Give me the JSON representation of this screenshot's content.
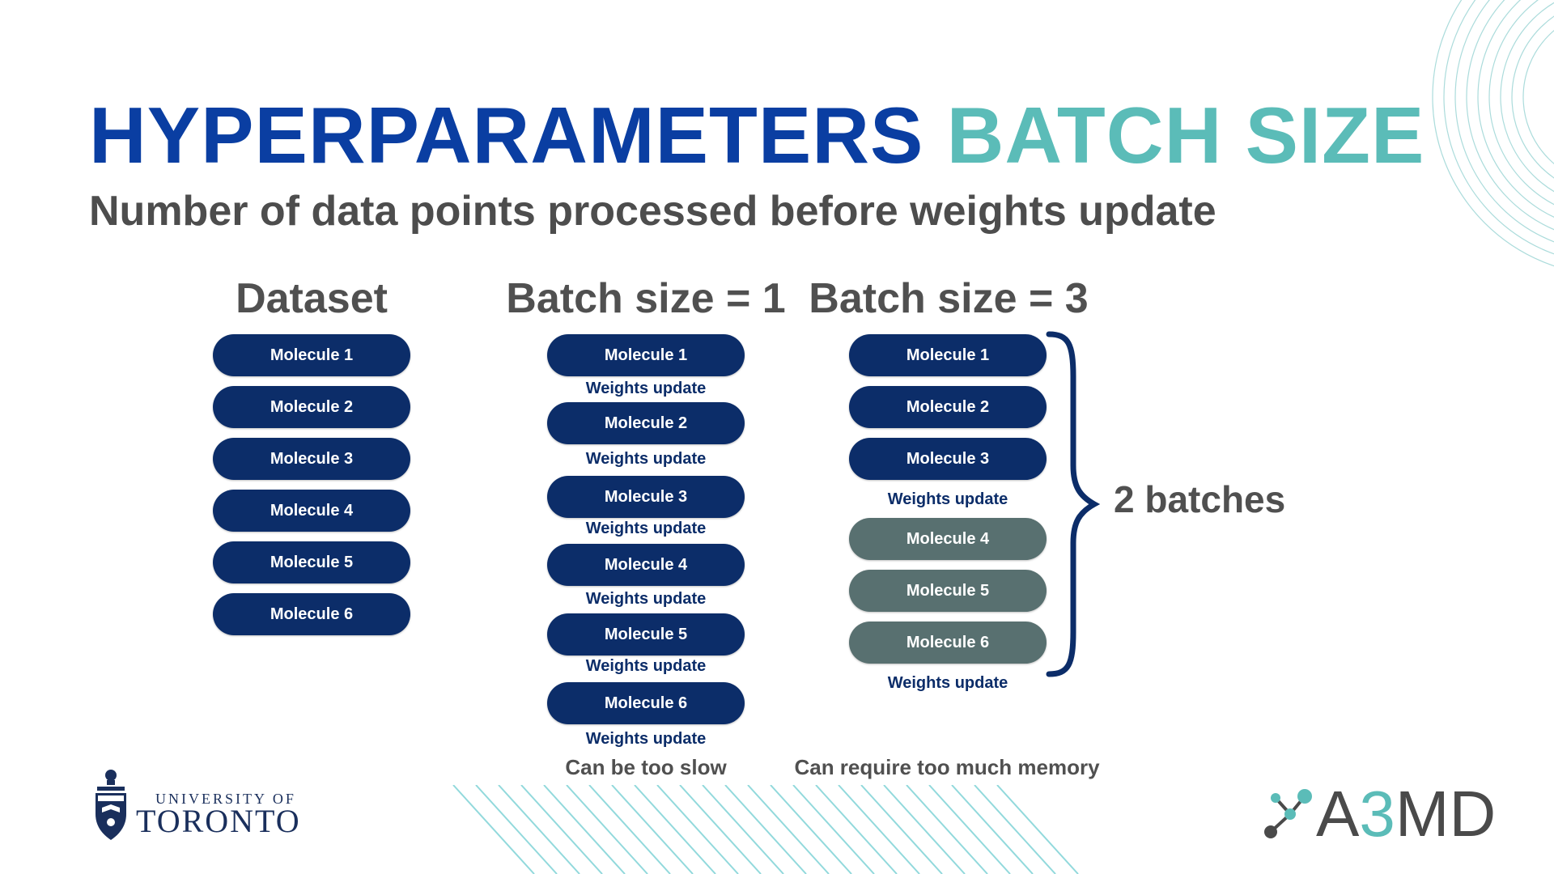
{
  "title": {
    "part1": "HYPERPARAMETERS",
    "part2": "BATCH SIZE"
  },
  "subtitle": "Number of data points processed before weights update",
  "columns": {
    "dataset": {
      "heading": "Dataset",
      "molecules": [
        "Molecule 1",
        "Molecule 2",
        "Molecule 3",
        "Molecule 4",
        "Molecule 5",
        "Molecule 6"
      ]
    },
    "batch1": {
      "heading": "Batch size = 1",
      "molecules": [
        "Molecule 1",
        "Molecule 2",
        "Molecule 3",
        "Molecule 4",
        "Molecule 5",
        "Molecule 6"
      ],
      "update_label": "Weights update",
      "note": "Can be too slow"
    },
    "batch3": {
      "heading": "Batch size = 3",
      "molecules": [
        "Molecule 1",
        "Molecule 2",
        "Molecule 3",
        "Molecule 4",
        "Molecule 5",
        "Molecule 6"
      ],
      "update_label": "Weights update",
      "note": "Can require too much memory",
      "brace_label": "2 batches"
    }
  },
  "logos": {
    "university_line1": "UNIVERSITY OF",
    "university_line2": "TORONTO",
    "a3md_prefix": "A",
    "a3md_three": "3",
    "a3md_suffix": "MD"
  },
  "colors": {
    "title_blue": "#0a3ea2",
    "title_teal": "#5bbcb8",
    "pill_navy": "#0c2d69",
    "pill_grey": "#587070",
    "text_grey": "#505050"
  }
}
